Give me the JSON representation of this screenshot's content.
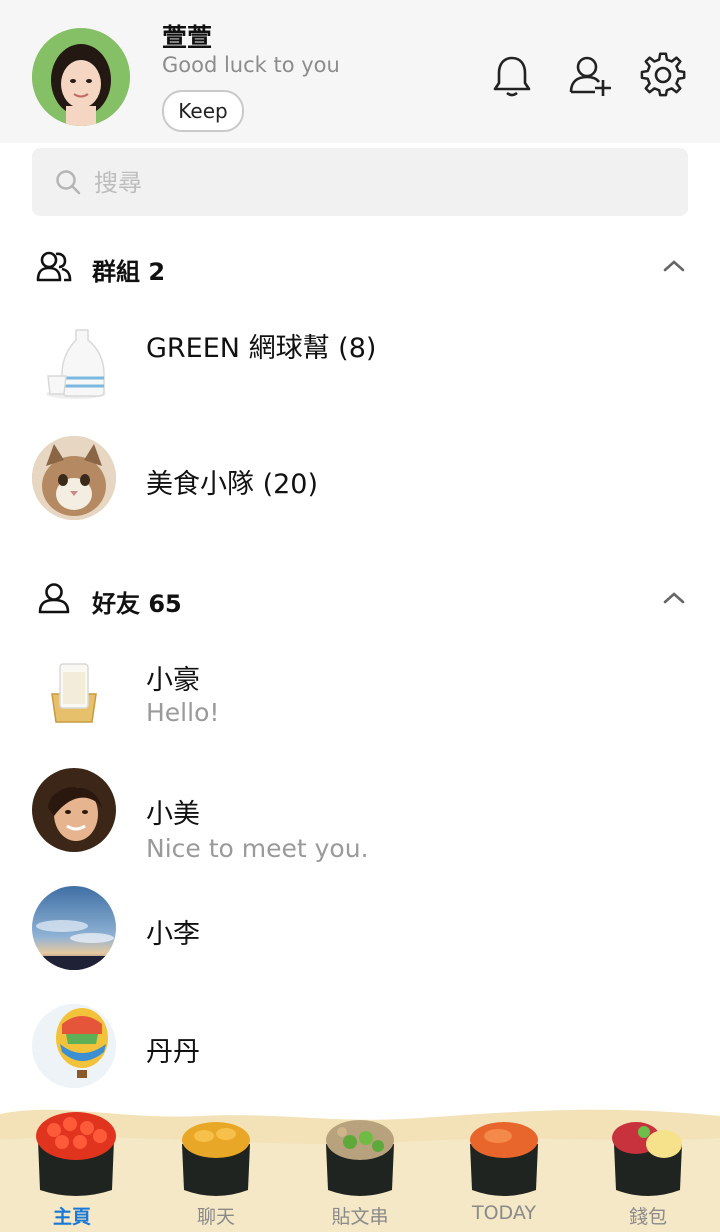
{
  "profile": {
    "name": "萱萱",
    "status": "Good luck to you",
    "keep_label": "Keep"
  },
  "header_icons": [
    "bell-icon",
    "add-friend-icon",
    "settings-icon"
  ],
  "search": {
    "placeholder": "搜尋"
  },
  "groups": {
    "title": "群組 2",
    "items": [
      {
        "name": "GREEN 網球幫 (8)",
        "icon": "sake-bottle"
      },
      {
        "name": "美食小隊 (20)",
        "icon": "cat-photo"
      }
    ]
  },
  "friends": {
    "title": "好友 65",
    "items": [
      {
        "name": "小豪",
        "status": "Hello!",
        "icon": "sake-cup"
      },
      {
        "name": "小美",
        "status": "Nice to meet you.",
        "icon": "woman-photo"
      },
      {
        "name": "小李",
        "status": "",
        "icon": "sky-photo"
      },
      {
        "name": "丹丹",
        "status": "",
        "icon": "balloon-photo"
      }
    ]
  },
  "tabs": [
    {
      "label": "主頁",
      "active": true,
      "icon": "ikura-sushi"
    },
    {
      "label": "聊天",
      "active": false,
      "icon": "uni-sushi"
    },
    {
      "label": "貼文串",
      "active": false,
      "icon": "negitoro-sushi"
    },
    {
      "label": "TODAY",
      "active": false,
      "icon": "tobiko-sushi"
    },
    {
      "label": "錢包",
      "active": false,
      "icon": "tuna-egg-sushi"
    }
  ],
  "colors": {
    "active_tab": "#1a78d6",
    "tabbar_background": "#f3e2b8",
    "header_background": "#f6f6f6"
  }
}
